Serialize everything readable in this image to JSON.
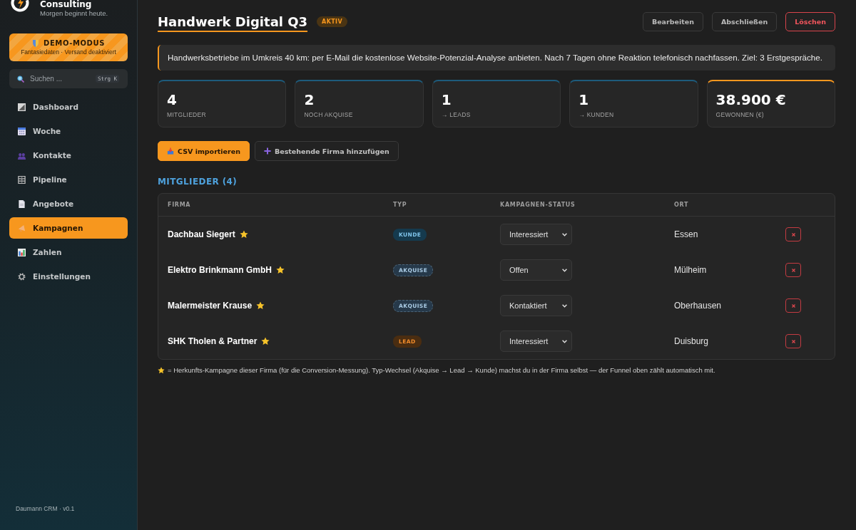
{
  "brand": {
    "title": "Consulting",
    "tagline": "Morgen beginnt heute."
  },
  "demo_banner": {
    "title": "DEMO-MODUS",
    "subtitle": "Fantasiedaten · Versand deaktiviert"
  },
  "search": {
    "placeholder": "Suchen ...",
    "shortcut": "Strg K"
  },
  "nav": [
    {
      "label": "Dashboard",
      "kind": "dashboard",
      "selected": false
    },
    {
      "label": "Woche",
      "kind": "week",
      "selected": false
    },
    {
      "label": "Kontakte",
      "kind": "contacts",
      "selected": false
    },
    {
      "label": "Pipeline",
      "kind": "pipeline",
      "selected": false
    },
    {
      "label": "Angebote",
      "kind": "offers",
      "selected": false
    },
    {
      "label": "Kampagnen",
      "kind": "campaigns",
      "selected": true
    },
    {
      "label": "Zahlen",
      "kind": "numbers",
      "selected": false
    },
    {
      "label": "Einstellungen",
      "kind": "settings",
      "selected": false
    }
  ],
  "sidebar_footer": "Daumann CRM · v0.1",
  "header": {
    "title": "Handwerk Digital Q3",
    "status_badge": "AKTIV",
    "buttons": [
      {
        "label": "Bearbeiten",
        "kind": "default"
      },
      {
        "label": "Abschließen",
        "kind": "default"
      },
      {
        "label": "Löschen",
        "kind": "danger"
      }
    ]
  },
  "description": "Handwerksbetriebe im Umkreis 40 km: per E-Mail die kostenlose Website-Potenzial-Analyse anbieten. Nach 7 Tagen ohne Reaktion telefonisch nachfassen. Ziel: 3 Erstgespräche.",
  "stats": [
    {
      "value": "4",
      "label": "MITGLIEDER",
      "highlighted": false
    },
    {
      "value": "2",
      "label": "NOCH AKQUISE",
      "highlighted": false
    },
    {
      "value": "1",
      "label": "→ LEADS",
      "highlighted": false
    },
    {
      "value": "1",
      "label": "→ KUNDEN",
      "highlighted": false
    },
    {
      "value": "38.900 €",
      "label": "GEWONNEN (€)",
      "highlighted": true
    }
  ],
  "actions": [
    {
      "label": "CSV importieren",
      "kind": "import"
    },
    {
      "label": "Bestehende Firma hinzufügen",
      "kind": "add"
    }
  ],
  "members": {
    "heading": "MITGLIEDER (4)",
    "columns": [
      "FIRMA",
      "TYP",
      "KAMPAGNEN-STATUS",
      "ORT"
    ],
    "rows": [
      {
        "company": "Dachbau Siegert",
        "origin": true,
        "type": {
          "label": "KUNDE",
          "kind": "customer"
        },
        "status": "Interessiert",
        "city": "Essen"
      },
      {
        "company": "Elektro Brinkmann GmbH",
        "origin": true,
        "type": {
          "label": "AKQUISE",
          "kind": "acquisition"
        },
        "status": "Offen",
        "city": "Mülheim"
      },
      {
        "company": "Malermeister Krause",
        "origin": true,
        "type": {
          "label": "AKQUISE",
          "kind": "acquisition"
        },
        "status": "Kontaktiert",
        "city": "Oberhausen"
      },
      {
        "company": "SHK Tholen & Partner",
        "origin": true,
        "type": {
          "label": "LEAD",
          "kind": "lead"
        },
        "status": "Interessiert",
        "city": "Duisburg"
      }
    ]
  },
  "legend": "= Herkunfts-Kampagne dieser Firma (für die Conversion-Messung). Typ-Wechsel (Akquise → Lead → Kunde) machst du in der Firma selbst — der Funnel oben zählt automatisch mit."
}
